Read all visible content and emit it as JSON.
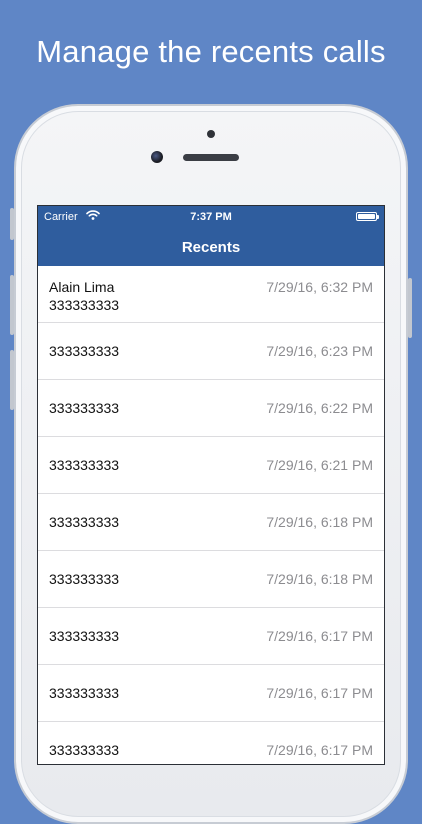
{
  "headline": "Manage the recents calls",
  "status_bar": {
    "carrier": "Carrier",
    "time": "7:37 PM",
    "wifi_icon": "wifi-icon",
    "battery_icon": "battery-icon"
  },
  "nav": {
    "title": "Recents"
  },
  "recents": [
    {
      "name": "Alain Lima",
      "number": "333333333",
      "date": "7/29/16, 6:32 PM"
    },
    {
      "name": "",
      "number": "333333333",
      "date": "7/29/16, 6:23 PM"
    },
    {
      "name": "",
      "number": "333333333",
      "date": "7/29/16, 6:22 PM"
    },
    {
      "name": "",
      "number": "333333333",
      "date": "7/29/16, 6:21 PM"
    },
    {
      "name": "",
      "number": "333333333",
      "date": "7/29/16, 6:18 PM"
    },
    {
      "name": "",
      "number": "333333333",
      "date": "7/29/16, 6:18 PM"
    },
    {
      "name": "",
      "number": "333333333",
      "date": "7/29/16, 6:17 PM"
    },
    {
      "name": "",
      "number": "333333333",
      "date": "7/29/16, 6:17 PM"
    },
    {
      "name": "",
      "number": "333333333",
      "date": "7/29/16, 6:17 PM"
    }
  ],
  "colors": {
    "background": "#5f86c6",
    "nav_bar": "#2f5d9e",
    "date_text": "#8c8c90"
  }
}
